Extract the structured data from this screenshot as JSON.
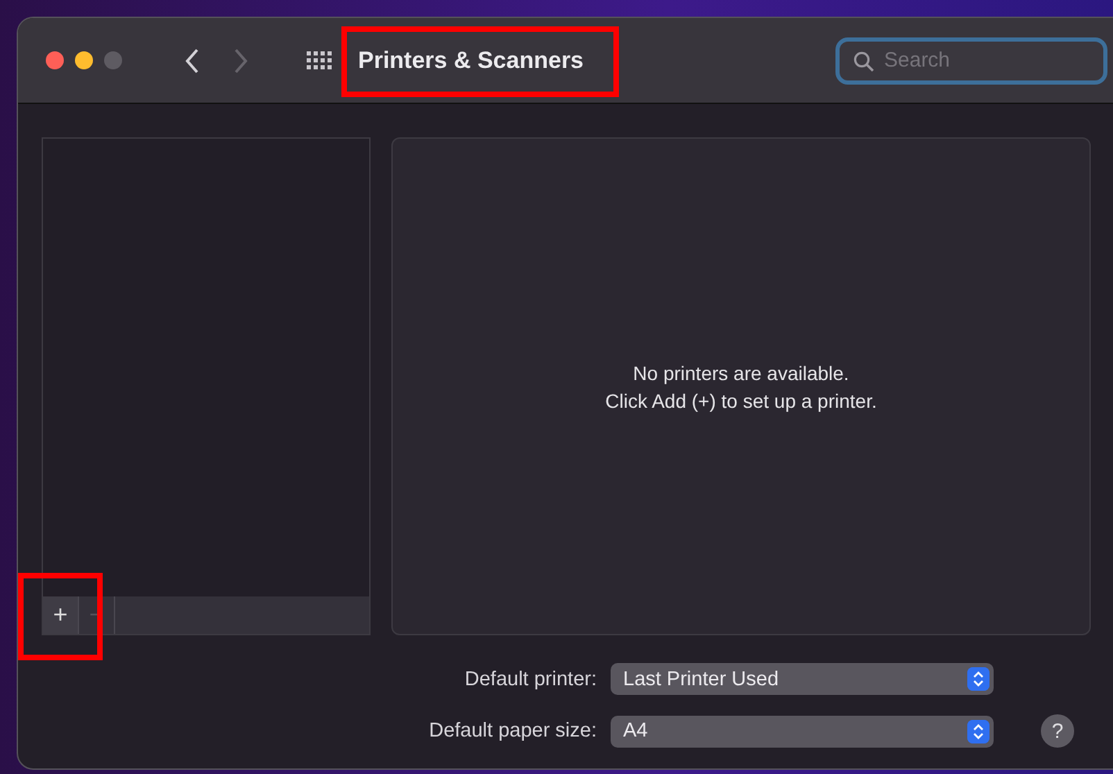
{
  "window": {
    "title": "Printers & Scanners",
    "highlighted": true
  },
  "toolbar": {
    "back_disabled": false,
    "forward_disabled": true
  },
  "search": {
    "placeholder": "Search",
    "focused": true
  },
  "printer_list": {
    "controls": [
      {
        "label": "+",
        "disabled": false,
        "highlighted": true
      },
      {
        "label": "−",
        "disabled": true,
        "highlighted": false
      }
    ]
  },
  "details": {
    "lines": [
      "No printers are available.",
      "Click Add (+) to set up a printer."
    ]
  },
  "settings": [
    {
      "label": "Default printer:",
      "value": "Last Printer Used"
    },
    {
      "label": "Default paper size:",
      "value": "A4"
    }
  ],
  "help": {
    "label": "?"
  }
}
